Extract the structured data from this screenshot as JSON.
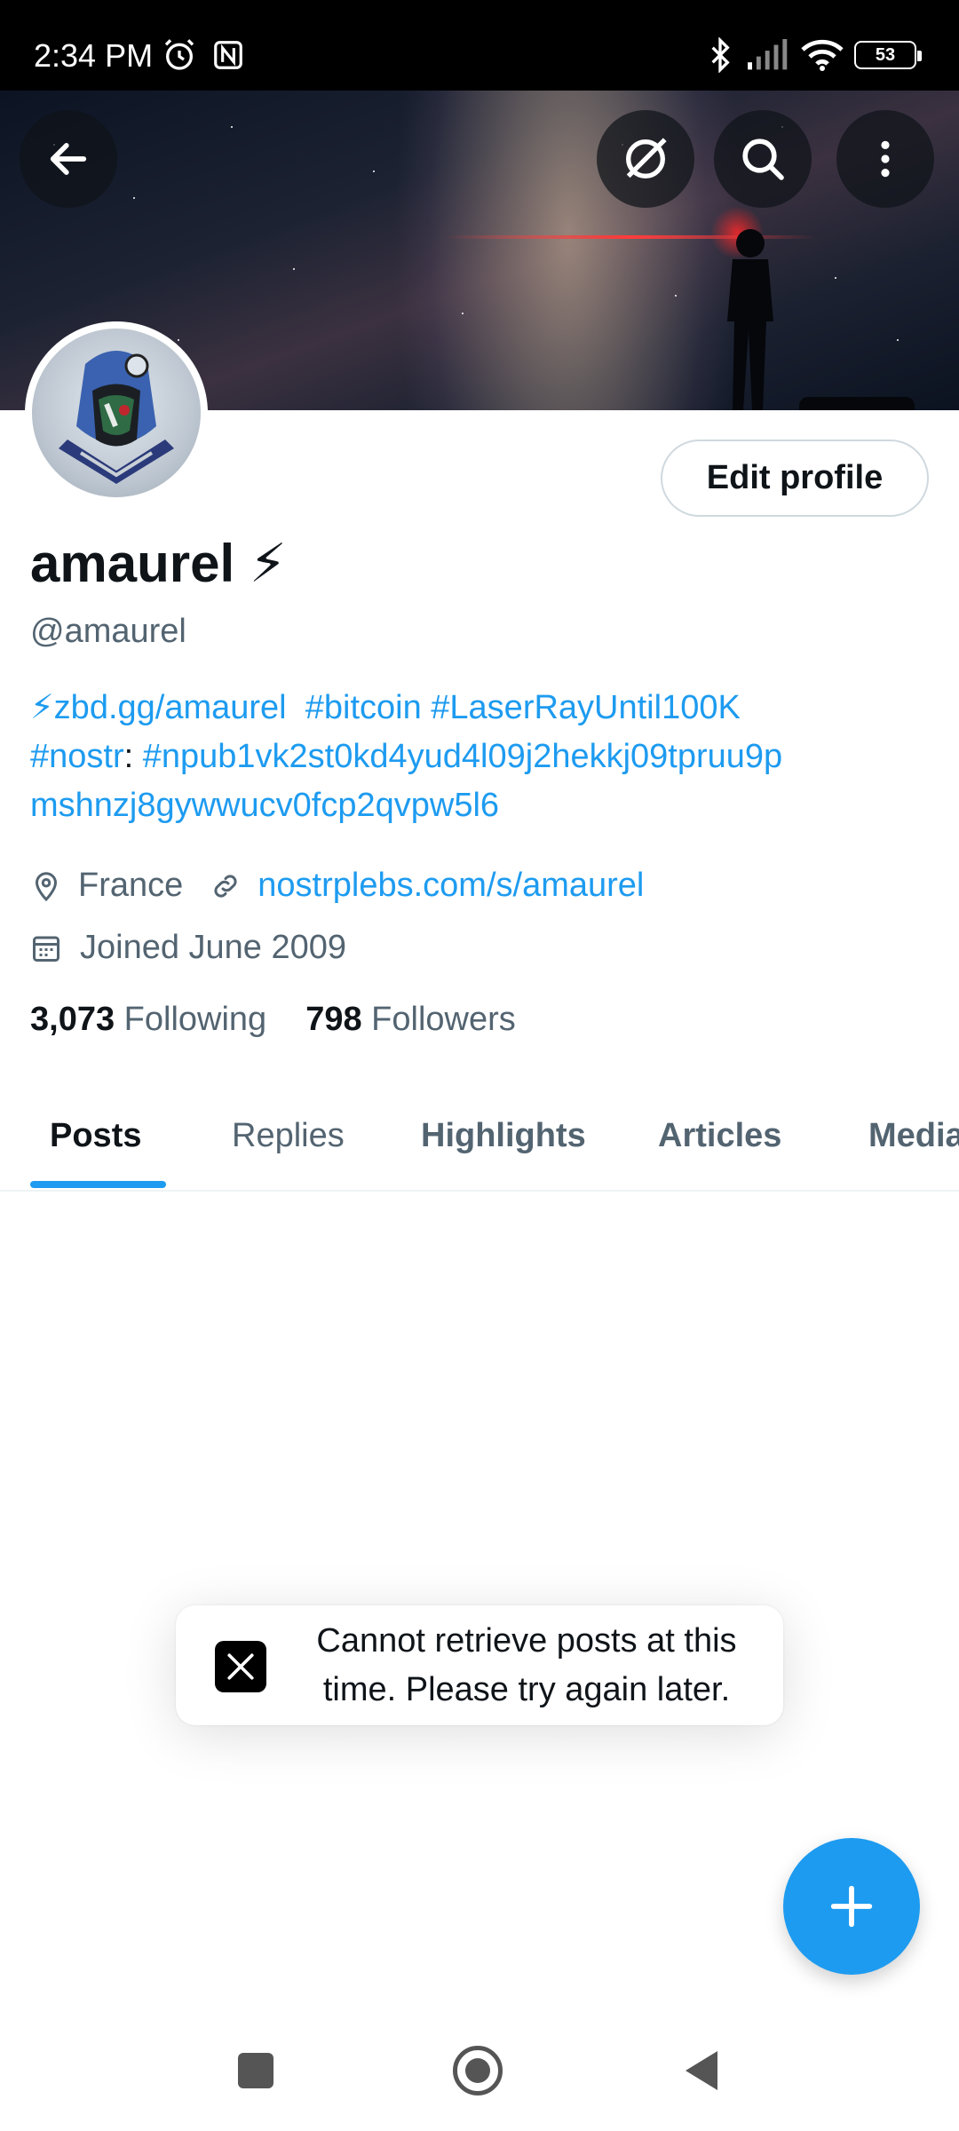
{
  "status_bar": {
    "time": "2:34 PM",
    "battery": "53"
  },
  "header": {
    "back_icon": "arrow-left-icon",
    "grok_icon": "grok-icon",
    "search_icon": "search-icon",
    "more_icon": "more-vertical-icon"
  },
  "profile": {
    "edit_label": "Edit profile",
    "display_name": "amaurel ⚡",
    "handle": "@amaurel",
    "bio_line1_link": "⚡zbd.gg/amaurel",
    "bio_line1_tags": "#bitcoin #LaserRayUntil100K",
    "bio_line2_tag": "#nostr",
    "bio_colon": ":",
    "bio_line2_npub": "#npub1vk2st0kd4yud4l09j2hekkj09tpruu9p",
    "bio_line3": "mshnzj8gywwucv0fcp2qvpw5l6",
    "location": "France",
    "website": "nostrplebs.com/s/amaurel",
    "joined": "Joined June 2009",
    "following_count": "3,073",
    "following_label": "Following",
    "followers_count": "798",
    "followers_label": "Followers"
  },
  "tabs": [
    {
      "label": "Posts"
    },
    {
      "label": "Replies"
    },
    {
      "label": "Highlights"
    },
    {
      "label": "Articles"
    },
    {
      "label": "Media"
    }
  ],
  "toast": {
    "line1": "Cannot retrieve posts at this",
    "line2": "time. Please try again later."
  },
  "colors": {
    "accent": "#1d9bf0",
    "text": "#0f1419",
    "muted": "#536471"
  }
}
